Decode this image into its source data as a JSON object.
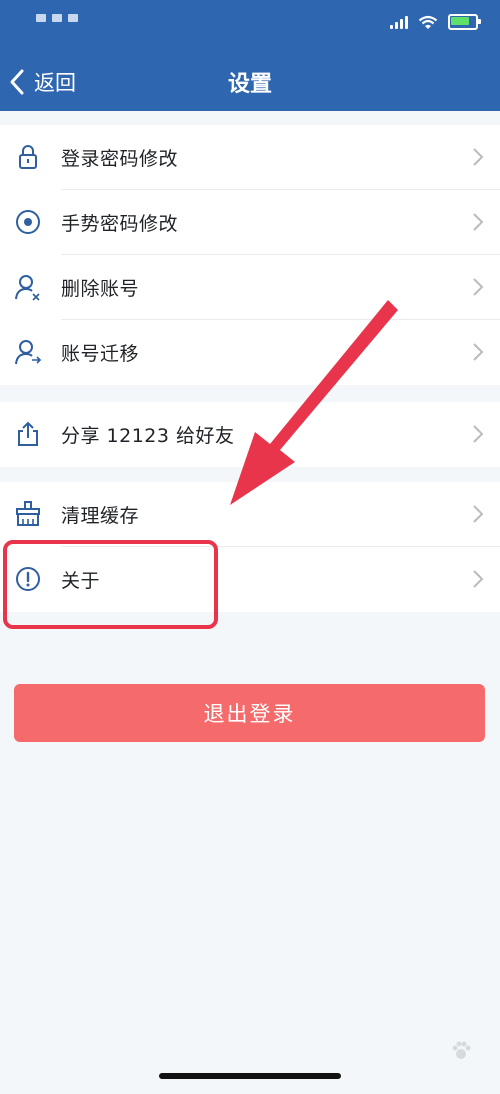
{
  "header": {
    "back_label": "返回",
    "title": "设置"
  },
  "groups": [
    {
      "items": [
        {
          "label": "登录密码修改",
          "icon": "lock-icon"
        },
        {
          "label": "手势密码修改",
          "icon": "gesture-circle-icon"
        },
        {
          "label": "删除账号",
          "icon": "user-delete-icon"
        },
        {
          "label": "账号迁移",
          "icon": "user-migrate-icon"
        }
      ]
    },
    {
      "items": [
        {
          "label": "分享 12123 给好友",
          "icon": "share-icon"
        }
      ]
    },
    {
      "items": [
        {
          "label": "清理缓存",
          "icon": "broom-icon"
        },
        {
          "label": "关于",
          "icon": "info-icon"
        }
      ]
    }
  ],
  "logout_label": "退出登录",
  "colors": {
    "header_bg": "#2f66b0",
    "icon_blue": "#2f5f9f",
    "logout_bg": "#f56a6b",
    "annotation_red": "#e8354c",
    "page_bg": "#f3f7f9"
  }
}
